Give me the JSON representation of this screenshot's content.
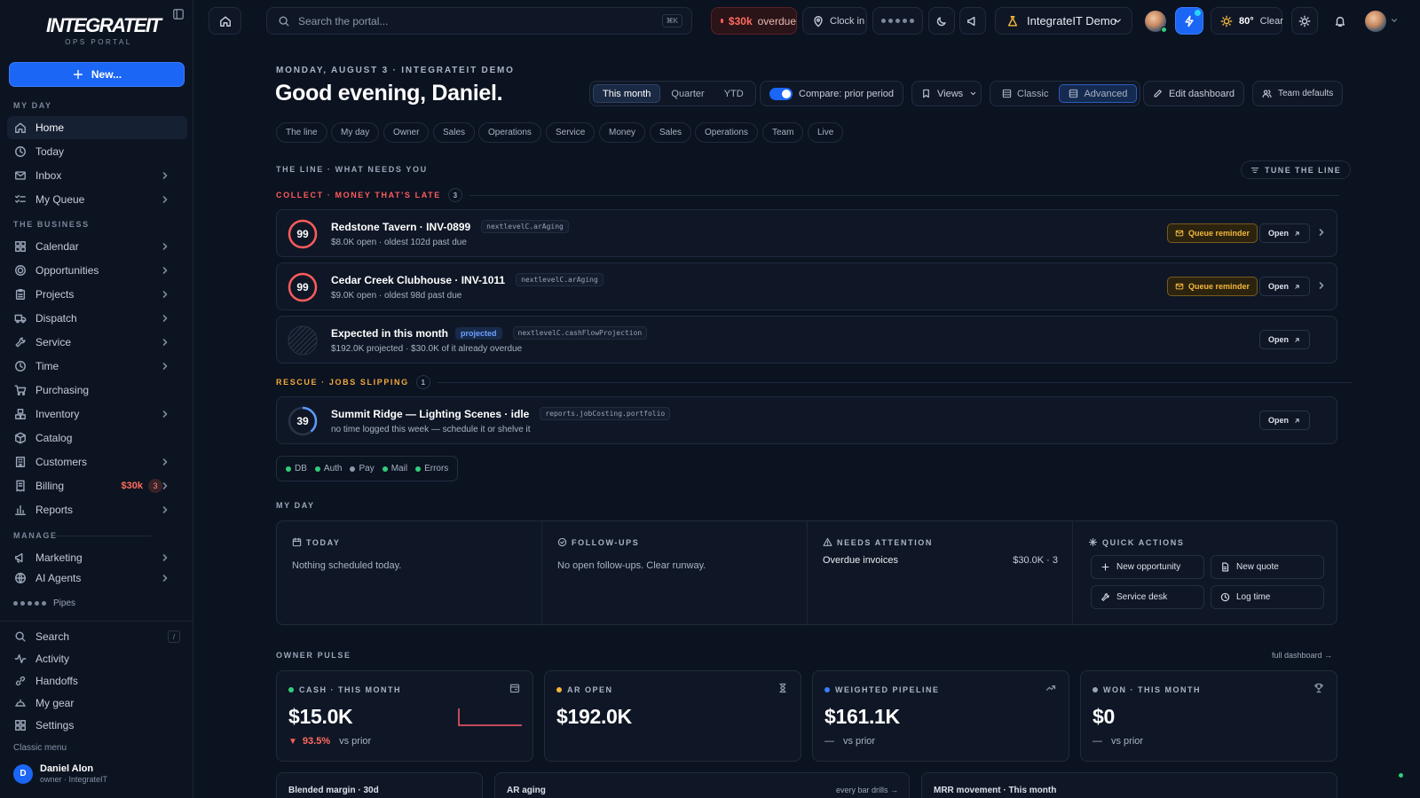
{
  "brand": {
    "logo": "INTEGRATEIT",
    "subtitle": "OPS PORTAL"
  },
  "sidebar": {
    "new_label": "New...",
    "sections": {
      "my_day": "MY DAY",
      "business": "THE BUSINESS",
      "manage": "MANAGE"
    },
    "my_day": [
      {
        "label": "Home",
        "icon": "home-icon"
      },
      {
        "label": "Today",
        "icon": "clock-icon"
      },
      {
        "label": "Inbox",
        "icon": "mail-icon"
      },
      {
        "label": "My Queue",
        "icon": "list-check-icon"
      }
    ],
    "business": [
      {
        "label": "Calendar",
        "icon": "grid-icon"
      },
      {
        "label": "Opportunities",
        "icon": "target-icon"
      },
      {
        "label": "Projects",
        "icon": "clipboard-icon"
      },
      {
        "label": "Dispatch",
        "icon": "truck-icon"
      },
      {
        "label": "Service",
        "icon": "wrench-icon"
      },
      {
        "label": "Time",
        "icon": "clock-icon"
      },
      {
        "label": "Purchasing",
        "icon": "cart-icon"
      },
      {
        "label": "Inventory",
        "icon": "boxes-icon"
      },
      {
        "label": "Catalog",
        "icon": "package-icon"
      },
      {
        "label": "Customers",
        "icon": "building-icon"
      },
      {
        "label": "Billing",
        "icon": "receipt-icon",
        "amount": "$30k",
        "count": "3"
      },
      {
        "label": "Reports",
        "icon": "bar-chart-icon"
      }
    ],
    "manage": [
      {
        "label": "Marketing",
        "icon": "megaphone-icon"
      },
      {
        "label": "AI Agents",
        "icon": "globe-icon"
      }
    ],
    "pipes_label": "Pipes",
    "utility": [
      {
        "label": "Search",
        "icon": "search-icon",
        "kbd": "/"
      },
      {
        "label": "Activity",
        "icon": "activity-icon"
      },
      {
        "label": "Handoffs",
        "icon": "link-icon"
      },
      {
        "label": "My gear",
        "icon": "helmet-icon"
      },
      {
        "label": "Settings",
        "icon": "grid-icon"
      }
    ],
    "classic_menu": "Classic menu",
    "user": {
      "initial": "D",
      "name": "Daniel Alon",
      "role": "owner · IntegrateIT"
    }
  },
  "topbar": {
    "search_placeholder": "Search the portal...",
    "search_kbd": "⌘K",
    "overdue_amount": "$30k",
    "overdue_label": "overdue",
    "clock_in": "Clock in",
    "org": "IntegrateIT Demo",
    "weather_temp": "80°",
    "weather_label": "Clear"
  },
  "header": {
    "date_line": "MONDAY, AUGUST 3 · INTEGRATEIT DEMO",
    "greeting": "Good evening, Daniel.",
    "periods": [
      "This month",
      "Quarter",
      "YTD"
    ],
    "compare": "Compare: prior period",
    "views": "Views",
    "modes": [
      "Classic",
      "Advanced"
    ],
    "edit": "Edit dashboard",
    "team": "Team defaults"
  },
  "tabs": [
    "The line",
    "My day",
    "Owner",
    "Sales",
    "Operations",
    "Service",
    "Money",
    "Sales",
    "Operations",
    "Team",
    "Live"
  ],
  "the_line": {
    "label": "THE LINE · WHAT NEEDS YOU",
    "tune": "TUNE THE LINE",
    "collect": {
      "label": "COLLECT · MONEY THAT'S LATE",
      "count": "3"
    },
    "rescue": {
      "label": "RESCUE · JOBS SLIPPING",
      "count": "1"
    },
    "items": [
      {
        "score": "99",
        "title": "Redstone Tavern · INV-0899",
        "code": "nextlevelC.arAging",
        "sub": "$8.0K open · oldest 102d past due",
        "action": "Queue reminder",
        "open": "Open"
      },
      {
        "score": "99",
        "title": "Cedar Creek Clubhouse · INV-1011",
        "code": "nextlevelC.arAging",
        "sub": "$9.0K open · oldest 98d past due",
        "action": "Queue reminder",
        "open": "Open"
      },
      {
        "score": "",
        "title": "Expected in this month",
        "tag": "projected",
        "code": "nextlevelC.cashFlowProjection",
        "sub": "$192.0K projected · $30.0K of it already overdue",
        "open": "Open"
      },
      {
        "score": "39",
        "title": "Summit Ridge — Lighting Scenes · idle",
        "code": "reports.jobCosting.portfolio",
        "sub": "no time logged this week — schedule it or shelve it",
        "open": "Open"
      }
    ],
    "health": [
      "DB",
      "Auth",
      "Pay",
      "Mail",
      "Errors"
    ]
  },
  "my_day": {
    "label": "MY DAY",
    "today": {
      "title": "TODAY",
      "body": "Nothing scheduled today."
    },
    "followups": {
      "title": "FOLLOW-UPS",
      "body": "No open follow-ups. Clear runway."
    },
    "attention": {
      "title": "NEEDS ATTENTION",
      "item": "Overdue invoices",
      "value": "$30.0K · 3"
    },
    "quick": {
      "title": "QUICK ACTIONS",
      "actions": [
        "New opportunity",
        "New quote",
        "Service desk",
        "Log time"
      ]
    }
  },
  "owner_pulse": {
    "label": "OWNER PULSE",
    "full": "full dashboard →",
    "cards": [
      {
        "title": "CASH · THIS MONTH",
        "value": "$15.0K",
        "delta": "93.5%",
        "vs": "vs prior",
        "dot": "#2fcf7a"
      },
      {
        "title": "AR OPEN",
        "value": "$192.0K",
        "dot": "#f2b73c"
      },
      {
        "title": "WEIGHTED PIPELINE",
        "value": "$161.1K",
        "delta": "—",
        "vs": "vs prior",
        "dot": "#3b7cff"
      },
      {
        "title": "WON · THIS MONTH",
        "value": "$0",
        "delta": "—",
        "vs": "vs prior",
        "dot": "#9aa5b8"
      }
    ]
  },
  "bottom_cards": [
    {
      "title": "Blended margin · 30d"
    },
    {
      "title": "AR aging",
      "right": "every bar drills →"
    },
    {
      "title": "MRR movement · This month"
    }
  ],
  "colors": {
    "accent": "#1b66f5",
    "danger": "#ff6b5e",
    "warning": "#f2b73c",
    "success": "#2fcf7a"
  }
}
